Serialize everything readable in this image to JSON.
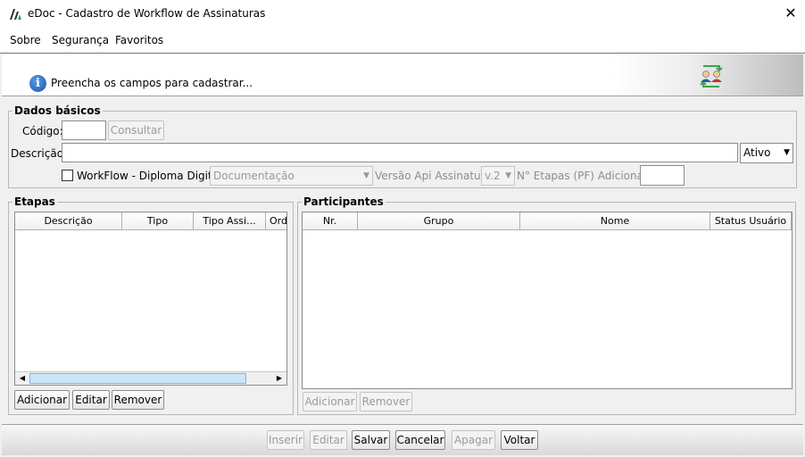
{
  "window": {
    "title": "eDoc - Cadastro de Workflow de Assinaturas"
  },
  "menu": {
    "sobre": "Sobre",
    "seguranca": "Segurança",
    "favoritos": "Favoritos"
  },
  "banner": {
    "message": "Preencha os campos para cadastrar..."
  },
  "dados_basicos": {
    "legend": "Dados básicos",
    "codigo_label": "Código:",
    "codigo_value": "",
    "consultar_label": "Consultar",
    "descricao_label": "Descrição:",
    "descricao_value": "",
    "status_value": "Ativo",
    "workflow_checkbox_label": "WorkFlow - Diploma Digital",
    "workflow_checked": false,
    "tipo_combo_value": "Documentação",
    "versao_api_label": "Versão Api Assinatura:",
    "versao_api_value": "v.2",
    "etapas_pf_label": "N° Etapas (PF) Adicionais:",
    "etapas_pf_value": ""
  },
  "etapas": {
    "legend": "Etapas",
    "columns": [
      "Descrição",
      "Tipo",
      "Tipo Assi...",
      "Ord"
    ],
    "rows": [],
    "buttons": {
      "adicionar": "Adicionar",
      "editar": "Editar",
      "remover": "Remover"
    }
  },
  "participantes": {
    "legend": "Participantes",
    "columns": [
      "Nr.",
      "Grupo",
      "Nome",
      "Status Usuário"
    ],
    "rows": [],
    "buttons": {
      "adicionar": "Adicionar",
      "remover": "Remover"
    }
  },
  "footer": {
    "inserir": "Inserir",
    "editar": "Editar",
    "salvar": "Salvar",
    "cancelar": "Cancelar",
    "apagar": "Apagar",
    "voltar": "Voltar"
  },
  "colors": {
    "titlebar": "#ffffff",
    "window_bg": "#f0f0f0",
    "info_icon": "#1a55b0",
    "disabled_text": "#9a9a9a"
  }
}
